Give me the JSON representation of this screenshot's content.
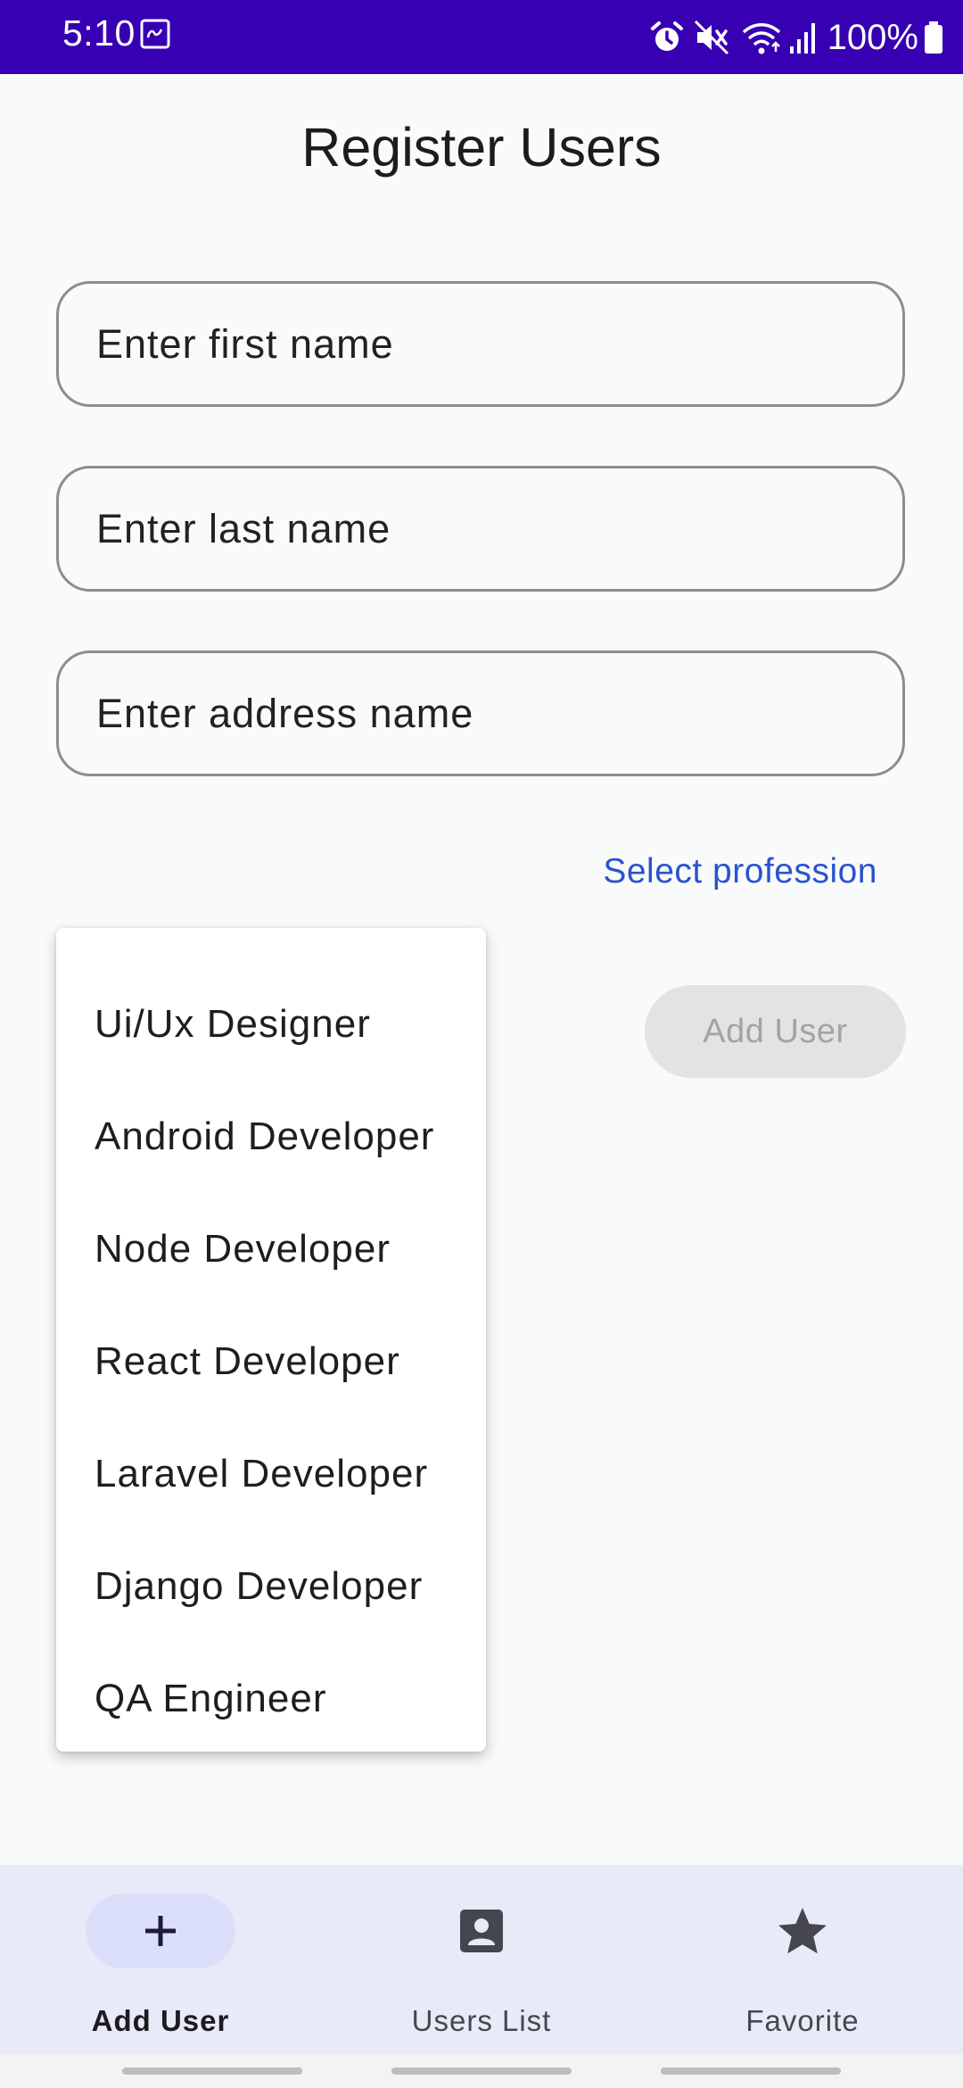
{
  "status_bar": {
    "time": "5:10",
    "battery": "100%",
    "icons": [
      "notification-icon",
      "alarm-icon",
      "mute-icon",
      "wifi-icon",
      "signal-icon",
      "battery-icon"
    ]
  },
  "page": {
    "title": "Register Users"
  },
  "form": {
    "first_name_placeholder": "Enter first name",
    "last_name_placeholder": "Enter last name",
    "address_placeholder": "Enter address name",
    "select_profession_label": "Select profession",
    "add_user_button": "Add User"
  },
  "profession_menu": {
    "options": [
      "Ui/Ux Designer",
      "Android Developer",
      "Node Developer",
      "React Developer",
      "Laravel Developer",
      "Django Developer",
      "QA Engineer"
    ]
  },
  "bottom_nav": {
    "items": [
      {
        "label": "Add User",
        "icon": "plus-icon",
        "active": true
      },
      {
        "label": "Users List",
        "icon": "contact-card-icon",
        "active": false
      },
      {
        "label": "Favorite",
        "icon": "star-icon",
        "active": false
      }
    ]
  },
  "colors": {
    "status_bar": "#3700b3",
    "accent_link": "#2a52d0",
    "nav_background": "#e8ebf7",
    "nav_active_pill": "#dcdffa"
  }
}
